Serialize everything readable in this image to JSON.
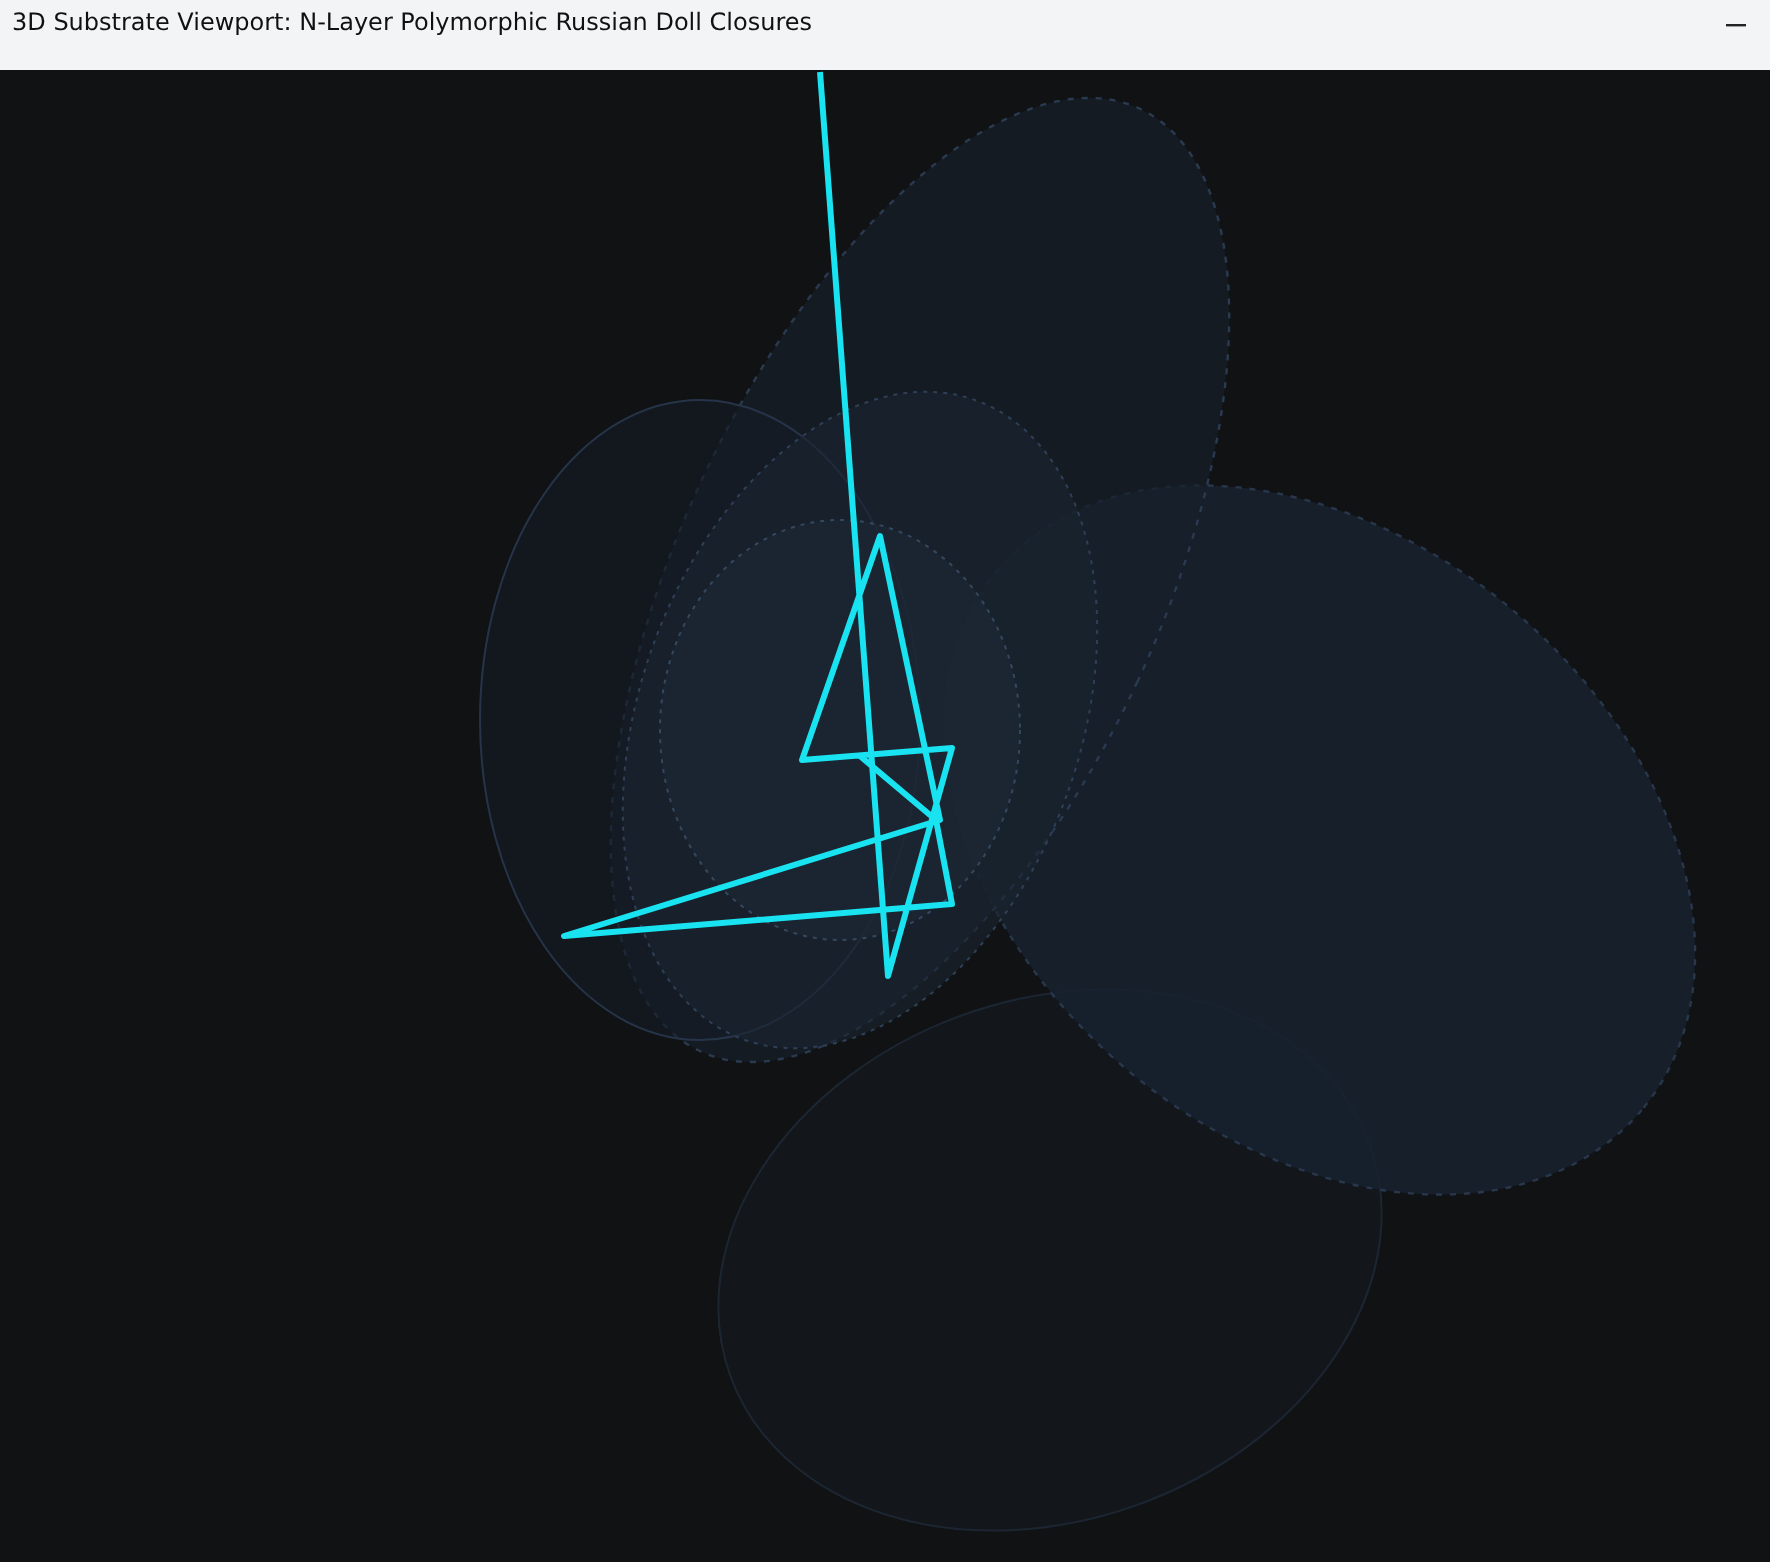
{
  "window": {
    "title": "3D Substrate Viewport: N-Layer Polymorphic Russian Doll Closures"
  }
}
